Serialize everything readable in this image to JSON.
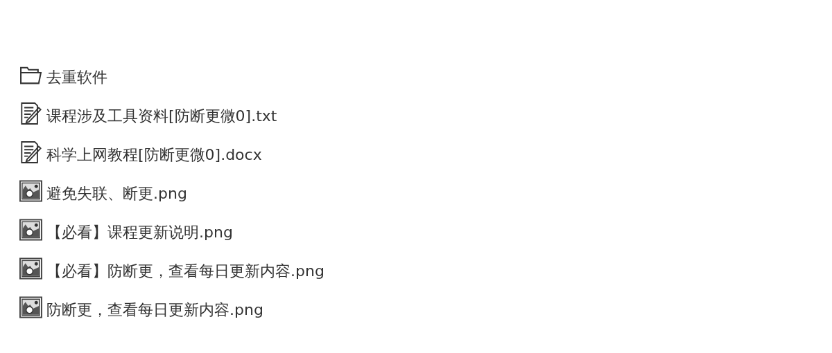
{
  "files": [
    {
      "kind": "folder",
      "name": "去重软件"
    },
    {
      "kind": "document",
      "name": "课程涉及工具资料[防断更微0].txt"
    },
    {
      "kind": "document",
      "name": "科学上网教程[防断更微0].docx"
    },
    {
      "kind": "image",
      "name": "避免失联、断更.png"
    },
    {
      "kind": "image",
      "name": "【必看】课程更新说明.png"
    },
    {
      "kind": "image",
      "name": "【必看】防断更，查看每日更新内容.png"
    },
    {
      "kind": "image",
      "name": "防断更，查看每日更新内容.png"
    }
  ]
}
